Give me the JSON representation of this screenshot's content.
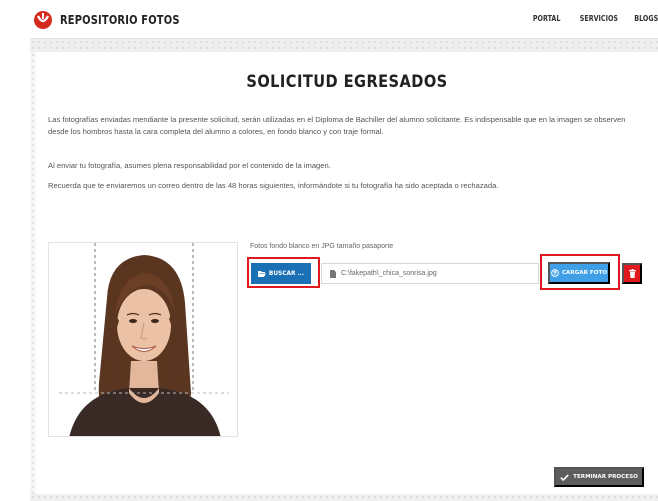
{
  "header": {
    "brand": "REPOSITORIO FOTOS",
    "logo_icon": "upc-logo-icon",
    "brand_color": "#d52b1e",
    "nav": [
      "PORTAL",
      "SERVICIOS",
      "BLOGS"
    ]
  },
  "main": {
    "title": "SOLICITUD EGRESADOS",
    "paragraphs": [
      "Las fotografías enviadas mendiante la presente solicitud, serán utilizadas en el Diploma de Bachiller del alumno solicitante. Es indispensable que en la imagen se observen desde los hombros hasta la cara completa del alumno a colores, en fondo blanco y con traje formal.",
      "Al enviar tu fotografía, asumes plena responsabilidad por el contenido de la imagen.",
      "Recuerda que te enviaremos un correo dentro de las 48 horas siguientes, informándote si tu fotografía ha sido aceptada o rechazada."
    ]
  },
  "upload": {
    "label": "Fotos fondo blanco en JPG tamaño pasaporte",
    "browse_label": "BUSCAR ...",
    "file_value": "C:\\fakepath\\_chica_sonrisa.jpg",
    "upload_label": "CARGAR FOTO",
    "colors": {
      "browse": "#1a6fb5",
      "upload": "#3fa0e8",
      "delete": "#e0191f",
      "highlight": "#e0191f"
    }
  },
  "footer": {
    "finish_label": "TERMINAR PROCESO"
  }
}
